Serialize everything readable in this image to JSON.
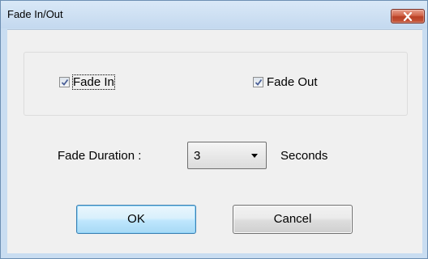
{
  "window": {
    "title": "Fade In/Out"
  },
  "options": {
    "fade_in": {
      "label": "Fade In",
      "checked": true
    },
    "fade_out": {
      "label": "Fade Out",
      "checked": true
    }
  },
  "duration": {
    "label": "Fade Duration :",
    "value": "3",
    "unit": "Seconds"
  },
  "buttons": {
    "ok": "OK",
    "cancel": "Cancel"
  },
  "colors": {
    "title_bar": "#c4d9ef",
    "close_button": "#c75a3e",
    "dialog_background": "#f0f0f0",
    "default_button": "#bee6fd"
  }
}
